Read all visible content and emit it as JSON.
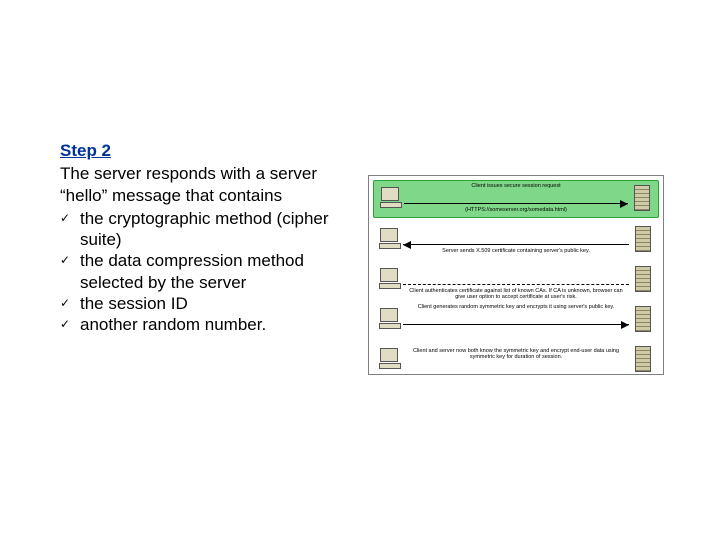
{
  "step_title": "Step 2",
  "intro": "The server responds with a server “hello” message that contains",
  "bullets": [
    "the cryptographic method (cipher suite)",
    "the data compression method selected by the server",
    "the session ID",
    "another random number."
  ],
  "diagram": {
    "highlighted_lane_index": 0,
    "lanes": [
      {
        "direction": "right",
        "caption_top": "Client issues secure session request",
        "caption_bottom": "(HTTPS://someserver.org/somedata.html)"
      },
      {
        "direction": "left",
        "caption_top": "",
        "caption_bottom": "Server sends X.509 certificate containing server's public key."
      },
      {
        "direction": "dashed",
        "caption_top": "",
        "caption_bottom": "Client authenticates certificate against list of known CAs. If CA is unknown, browser can give user option to accept certificate at user's risk."
      },
      {
        "direction": "right",
        "caption_top": "Client generates random symmetric key and encrypts it using server's public key.",
        "caption_bottom": ""
      },
      {
        "direction": "none",
        "caption_mid": "Client and server now both know the symmetric key and encrypt end-user data using symmetric key for duration of session."
      }
    ]
  }
}
